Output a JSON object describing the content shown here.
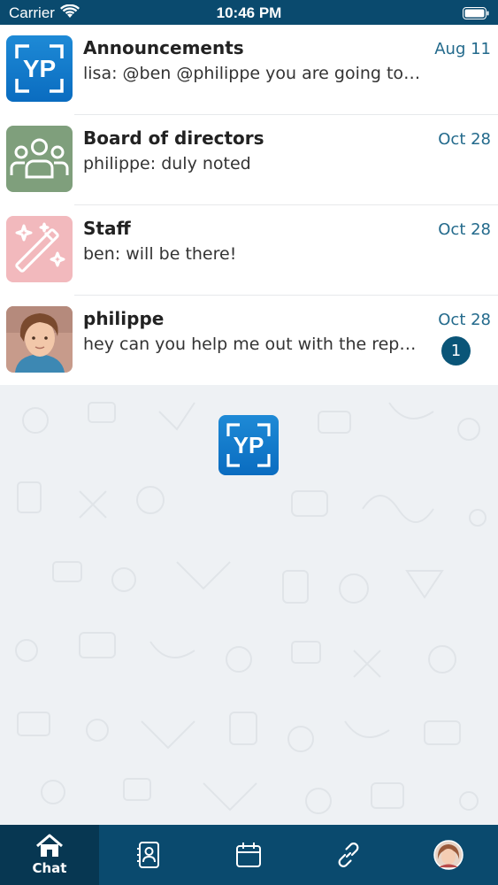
{
  "status_bar": {
    "carrier": "Carrier",
    "time": "10:46 PM"
  },
  "chats": [
    {
      "title": "Announcements",
      "preview": "lisa: @ben @philippe you are going to li...",
      "date": "Aug 11",
      "avatar": "yp-logo-icon",
      "logo_text": "YP"
    },
    {
      "title": "Board of directors",
      "preview": "philippe: duly noted",
      "date": "Oct 28",
      "avatar": "group-icon",
      "color": "#7f9f7c"
    },
    {
      "title": "Staff",
      "preview": "ben: will be there!",
      "date": "Oct 28",
      "avatar": "magic-wand-icon",
      "color": "#f2b9bd"
    },
    {
      "title": "philippe",
      "preview": "hey can you help me out with the repo...",
      "date": "Oct 28",
      "avatar": "user-photo",
      "unread": "1"
    }
  ],
  "center_logo_text": "YP",
  "tabs": [
    {
      "label": "Chat",
      "icon": "home-icon",
      "active": true
    },
    {
      "label": "",
      "icon": "contacts-icon"
    },
    {
      "label": "",
      "icon": "calendar-icon"
    },
    {
      "label": "",
      "icon": "link-icon"
    },
    {
      "label": "",
      "icon": "profile-avatar"
    }
  ],
  "colors": {
    "brand": "#0a4a6e",
    "accent": "#236a8c",
    "badge": "#0a5578"
  }
}
